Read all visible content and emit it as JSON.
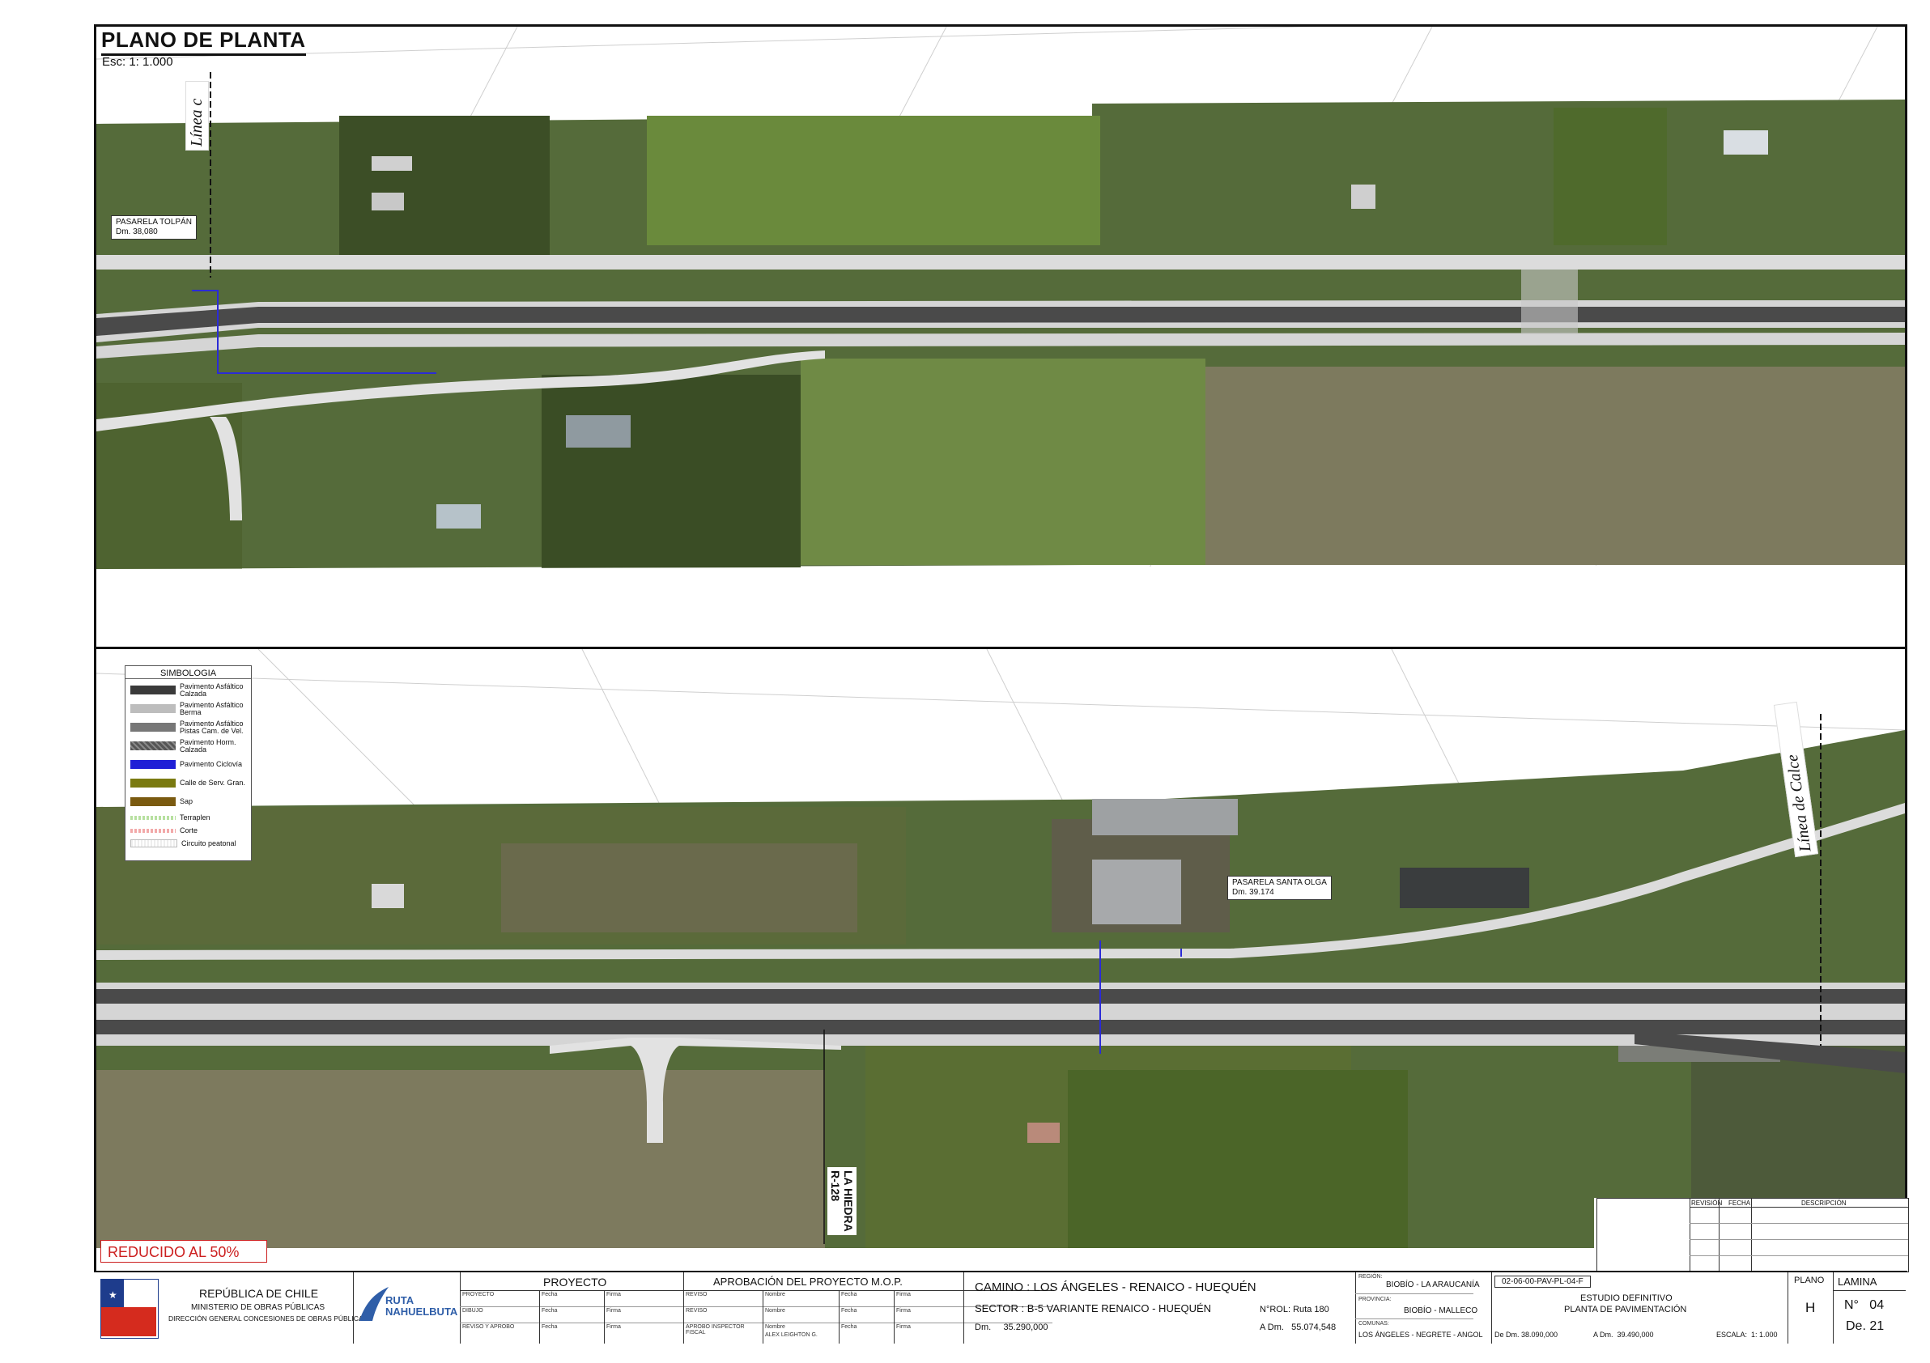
{
  "header": {
    "title": "PLANO DE PLANTA",
    "scale": "Esc: 1: 1.000"
  },
  "labels": {
    "pasarela_tolpan": {
      "name": "PASARELA TOLPÁN",
      "dm": "Dm. 38,080"
    },
    "pasarela_santa_olga": {
      "name": "PASARELA SANTA OLGA",
      "dm": "Dm. 39.174"
    },
    "linea_calce_top": "Línea c",
    "linea_calce_bottom": "Línea de Calce",
    "road_side": "LA HIEDRA\nR-128",
    "reducido": "REDUCIDO AL 50%"
  },
  "legend": {
    "title": "SIMBOLOGIA",
    "items": [
      {
        "label": "Pavimento Asfáltico Calzada",
        "color": "#3a3a3a"
      },
      {
        "label": "Pavimento Asfáltico Berma",
        "color": "#bdbdbd"
      },
      {
        "label": "Pavimento Asfáltico Pistas Cam. de Vel.",
        "color": "#777777"
      },
      {
        "label": "Pavimento Horm. Calzada",
        "color": "#555555"
      },
      {
        "label": "Pavimento Ciclovía",
        "color": "#1f1fd6"
      },
      {
        "label": "Calle de Serv. Gran.",
        "color": "#7a7a10"
      },
      {
        "label": "Sap",
        "color": "#7a5a10"
      },
      {
        "label": "Terraplen",
        "color": "#b7e0a0"
      },
      {
        "label": "Corte",
        "color": "#f2a9a9"
      },
      {
        "label": "Circuito peatonal",
        "color": "#e6e6e6"
      }
    ]
  },
  "titleblock": {
    "republic": "REPÚBLICA DE CHILE",
    "ministry": "MINISTERIO DE OBRAS PÚBLICAS",
    "direction": "DIRECCIÓN GENERAL CONCESIONES DE OBRAS PÚBLICAS",
    "logo_text": "RUTA NAHUELBUTA",
    "proyecto_header": "PROYECTO",
    "aprobacion_header": "APROBACIÓN DEL PROYECTO M.O.P.",
    "rows_left": [
      "PROYECTO",
      "DIBUJO",
      "REVISO Y APROBO"
    ],
    "col_fecha": "Fecha",
    "col_firma": "Firma",
    "rows_right": [
      "REVISO",
      "REVISO",
      "APROBO INSPECTOR FISCAL"
    ],
    "col_nombre": "Nombre",
    "aprobo_nombre": "ALEX LEIGHTON G.",
    "camino": "CAMINO : LOS ÁNGELES - RENAICO - HUEQUÉN",
    "sector": "SECTOR : B-5 VARIANTE RENAICO - HUEQUÉN",
    "nrol": "N°ROL: Ruta 180",
    "dm": "Dm.     35.290,000",
    "adm": "A Dm.   55.074,548",
    "region_label": "REGIÓN:",
    "region": "BIOBÍO - LA ARAUCANÍA",
    "provincia_label": "PROVINCIA:",
    "provincia": "BIOBÍO - MALLECO",
    "comunas_label": "COMUNAS:",
    "comunas": "LOS ÁNGELES - NEGRETE - ANGOL",
    "code": "02-06-00-PAV-PL-04-F",
    "estudio": "ESTUDIO DEFINITIVO",
    "planta": "PLANTA DE PAVIMENTACIÓN",
    "de_dm": "De Dm. 38.090,000",
    "a_dm": "A Dm.  39.490,000",
    "escala": "ESCALA:  1: 1.000",
    "plano_label": "PLANO",
    "plano_value": "H",
    "lamina_label": "LAMINA",
    "lamina_no": "N°   04",
    "lamina_de": "De. 21"
  },
  "revision": {
    "col1": "REVISIÓN",
    "col2": "FECHA",
    "col3": "DESCRIPCIÓN"
  }
}
